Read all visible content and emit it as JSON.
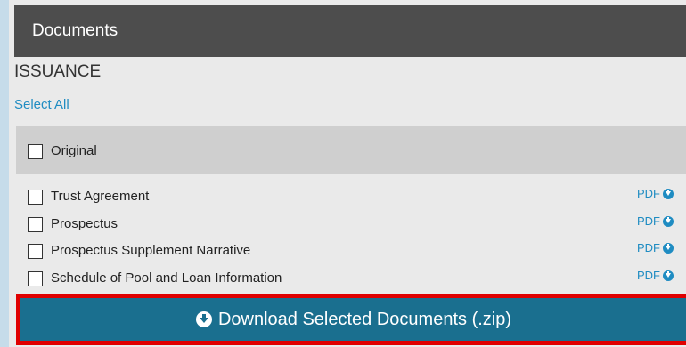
{
  "panel": {
    "header_title": "Documents",
    "section_title": "ISSUANCE",
    "select_all_label": "Select All"
  },
  "group": {
    "label": "Original",
    "checked": false
  },
  "documents": [
    {
      "label": "Trust Agreement",
      "format": "PDF",
      "checked": false
    },
    {
      "label": "Prospectus",
      "format": "PDF",
      "checked": false
    },
    {
      "label": "Prospectus Supplement Narrative",
      "format": "PDF",
      "checked": false
    },
    {
      "label": "Schedule of Pool and Loan Information",
      "format": "PDF",
      "checked": false
    }
  ],
  "download_button": {
    "label": "Download Selected Documents (.zip)",
    "icon": "download-circle-icon"
  },
  "colors": {
    "header_bg": "#4d4d4d",
    "link": "#1f8cc2",
    "button_bg": "#1a6f8f",
    "highlight_border": "#e00000"
  }
}
